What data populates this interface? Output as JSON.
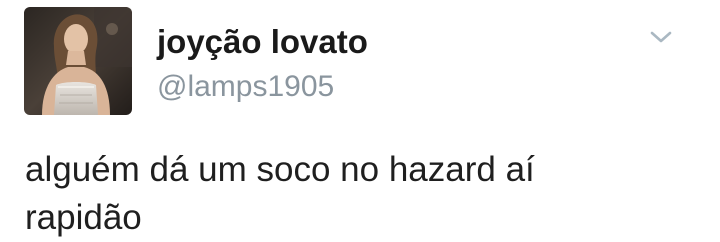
{
  "tweet": {
    "display_name": "joyção lovato",
    "handle": "@lamps1905",
    "text": "alguém dá um soco no hazard aí\nrapidão"
  },
  "icons": {
    "menu": "chevron-down-icon",
    "avatar": "profile-photo"
  },
  "colors": {
    "name": "#1a1a1a",
    "handle": "#8a959e",
    "text": "#1f1f1f",
    "chevron": "#aab8c2"
  }
}
